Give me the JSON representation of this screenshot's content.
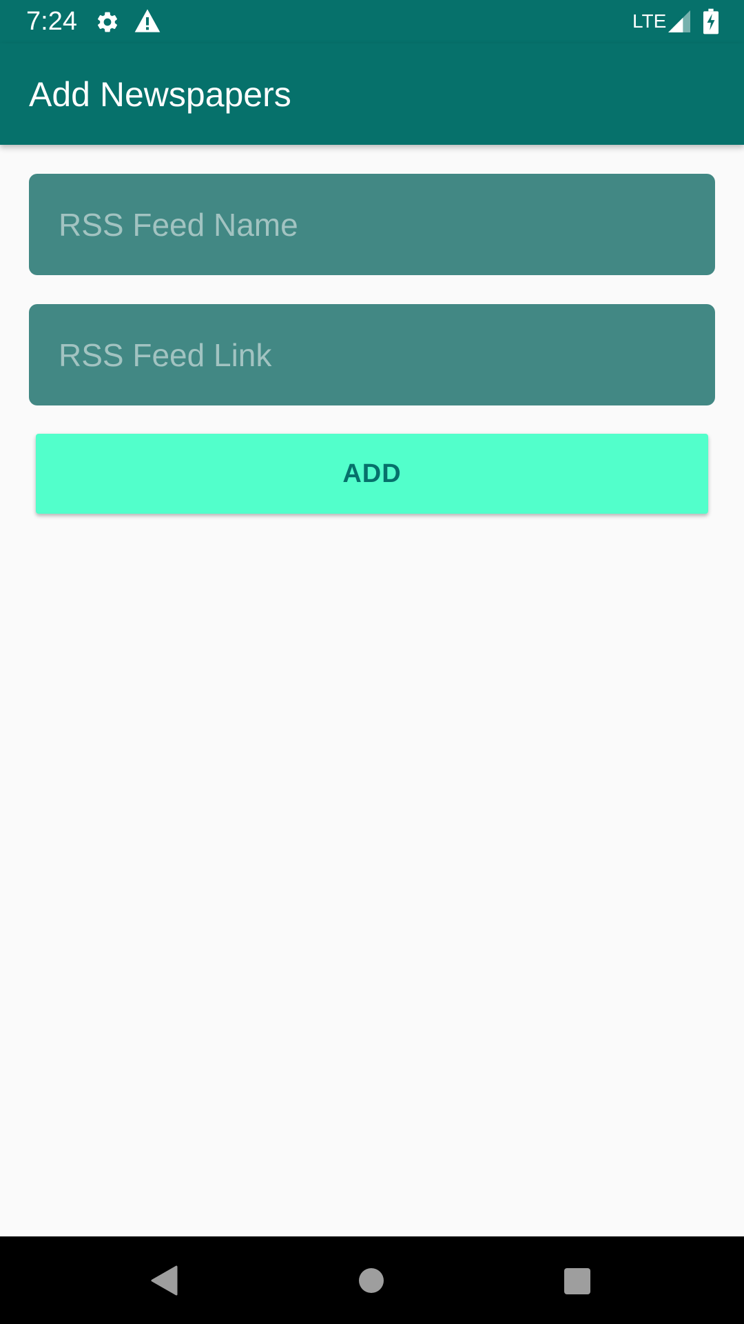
{
  "status_bar": {
    "time": "7:24",
    "network": "LTE",
    "icons": [
      "settings-icon",
      "warning-icon",
      "signal-icon",
      "battery-charging-icon"
    ],
    "background_color": "#06716b"
  },
  "app_bar": {
    "title": "Add Newspapers",
    "background_color": "#06716b"
  },
  "form": {
    "feed_name": {
      "value": "",
      "placeholder": "RSS Feed Name"
    },
    "feed_link": {
      "value": "",
      "placeholder": "RSS Feed Link"
    },
    "add_button_label": "ADD",
    "field_color": "#428884",
    "button_color": "#52ffcb",
    "button_text_color": "#06716b"
  },
  "nav_bar": {
    "icons": [
      "back-icon",
      "home-icon",
      "recents-icon"
    ]
  }
}
